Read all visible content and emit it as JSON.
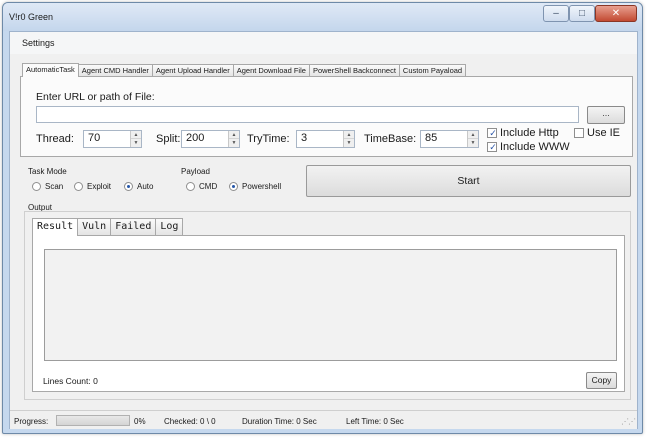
{
  "window": {
    "title": "V!r0 Green"
  },
  "window_controls": {
    "minimize": "–",
    "maximize": "□",
    "close": "✕"
  },
  "menu": {
    "settings": "Settings"
  },
  "tabs": [
    {
      "label": "AutomaticTask",
      "active": true
    },
    {
      "label": "Agent CMD Handler",
      "active": false
    },
    {
      "label": "Agent Upload Handler",
      "active": false
    },
    {
      "label": "Agent Download File",
      "active": false
    },
    {
      "label": "PowerShell Backconnect",
      "active": false
    },
    {
      "label": "Custom Payaload",
      "active": false
    }
  ],
  "task": {
    "url_label": "Enter URL or path of File:",
    "url_value": "",
    "browse_label": "...",
    "thread_label": "Thread:",
    "thread_value": "70",
    "split_label": "Split:",
    "split_value": "200",
    "trytime_label": "TryTime:",
    "trytime_value": "3",
    "timebase_label": "TimeBase:",
    "timebase_value": "85",
    "include_http_label": "Include Http",
    "include_http_checked": true,
    "use_ie_label": "Use IE",
    "use_ie_checked": false,
    "include_www_label": "Include WWW",
    "include_www_checked": true
  },
  "task_mode": {
    "label": "Task Mode",
    "options": [
      "Scan",
      "Exploit",
      "Auto"
    ],
    "selected": "Auto"
  },
  "payload": {
    "label": "Payload",
    "options": [
      "CMD",
      "Powershell"
    ],
    "selected": "Powershell"
  },
  "start_label": "Start",
  "output": {
    "label": "Output",
    "tabs": [
      "Result",
      "Vuln",
      "Failed",
      "Log"
    ],
    "active_tab": "Result",
    "lines_count": "Lines Count: 0",
    "copy_label": "Copy"
  },
  "status": {
    "progress_label": "Progress:",
    "progress_fraction": 0,
    "progress_text": "0%",
    "checked": "Checked:  0 \\ 0",
    "duration": "Duration Time:  0 Sec",
    "left": "Left Time:  0 Sec",
    "grip": "⋰⋰"
  },
  "colors": {
    "window_frame": "#c5d8ee",
    "close_button": "#c24a32",
    "progress_fill": "#3bb33b",
    "checkmark": "#2b56a8"
  }
}
